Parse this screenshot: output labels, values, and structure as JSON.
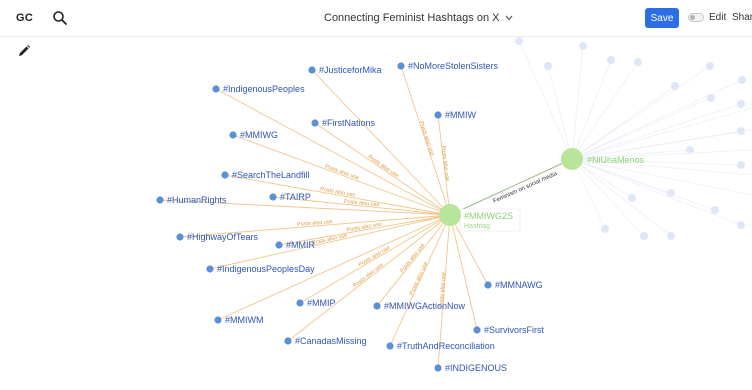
{
  "header": {
    "logo": "GC",
    "title": "Connecting Feminist Hashtags on X",
    "save_label": "Save",
    "edit_label": "Edit",
    "share_label": "Share"
  },
  "colors": {
    "accent": "#2b6ee5",
    "node": "#5b8fd8",
    "node_label": "#2f55b8",
    "edge": "#f2c58a",
    "edge_label": "#d79a3a",
    "center_node": "#b9e59a",
    "faded": "#dfe6f7"
  },
  "graph": {
    "center": {
      "label": "#MMIWG2S",
      "sublabel": "Hashtag"
    },
    "secondary": {
      "label": "#NiUnaMenos",
      "edge_label": "Feminism on social media"
    },
    "edge_label": "Posts also use",
    "nodes": [
      {
        "id": "justice",
        "label": "#JusticeforMika"
      },
      {
        "id": "stolen",
        "label": "#NoMoreStolenSisters"
      },
      {
        "id": "indig",
        "label": "#IndigenousPeoples"
      },
      {
        "id": "first",
        "label": "#FirstNations"
      },
      {
        "id": "mmiw",
        "label": "#MMIW"
      },
      {
        "id": "mmiwg",
        "label": "#MMIWG"
      },
      {
        "id": "search",
        "label": "#SearchTheLandfill"
      },
      {
        "id": "human",
        "label": "#HumanRights"
      },
      {
        "id": "tairp",
        "label": "#TAIRP"
      },
      {
        "id": "highway",
        "label": "#HighwayOfTears"
      },
      {
        "id": "mmir",
        "label": "#MMIR"
      },
      {
        "id": "ipday",
        "label": "#IndigenousPeoplesDay"
      },
      {
        "id": "mmip",
        "label": "#MMIP"
      },
      {
        "id": "mmiwm",
        "label": "#MMIWM"
      },
      {
        "id": "action",
        "label": "#MMIWGActionNow"
      },
      {
        "id": "canada",
        "label": "#CanadasMissing"
      },
      {
        "id": "truth",
        "label": "#TruthAndReconciliation"
      },
      {
        "id": "survivors",
        "label": "#SurvivorsFirst"
      },
      {
        "id": "mmnawg",
        "label": "#MMNAWG"
      },
      {
        "id": "indigenous",
        "label": "#INDIGENOUS"
      }
    ]
  }
}
